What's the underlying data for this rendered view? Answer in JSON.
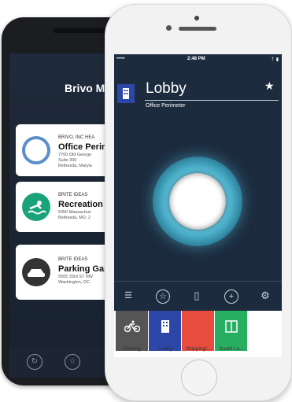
{
  "android": {
    "title": "Brivo M",
    "cards": [
      {
        "org": "BRIVO, INC HEA",
        "name": "Office Perim",
        "addr": "7700 Old George\nSuite 300\nBethesda, Maryla",
        "icon": "brivo-logo-icon",
        "icon_color": "#5a8fc7"
      },
      {
        "org": "BRITE IDEAS",
        "name": "Recreation C",
        "addr": "5450 Massachus\nBethesda, MD, 2",
        "icon": "swimmer-icon",
        "icon_color": "#1aa37a"
      },
      {
        "org": "BRITE IDEAS",
        "name": "Parking Gar",
        "addr": "5505 33rd ST NW\nWashington, DC.",
        "icon": "car-icon",
        "icon_color": "#333333"
      }
    ],
    "bottom_icons": [
      "refresh-icon",
      "star-icon"
    ]
  },
  "iphone": {
    "status_left": "•••••",
    "time": "2:48 PM",
    "status_right": "⇡ ▮",
    "title": "Lobby",
    "subtitle": "Office Perimeter",
    "accent": "#2d47a8",
    "toolbar": [
      "list-icon",
      "star-icon",
      "door-icon",
      "add-icon",
      "gear-icon"
    ],
    "tiles": [
      {
        "label": "Parking",
        "color": "#555555",
        "glyph": "bicycle-icon"
      },
      {
        "label": "Lobby",
        "color": "#2d47a8",
        "glyph": "building-icon"
      },
      {
        "label": "Shipping/...",
        "color": "#e74c3c",
        "glyph": ""
      },
      {
        "label": "South Lo...",
        "color": "#27ae60",
        "glyph": "door-double-icon"
      }
    ]
  }
}
